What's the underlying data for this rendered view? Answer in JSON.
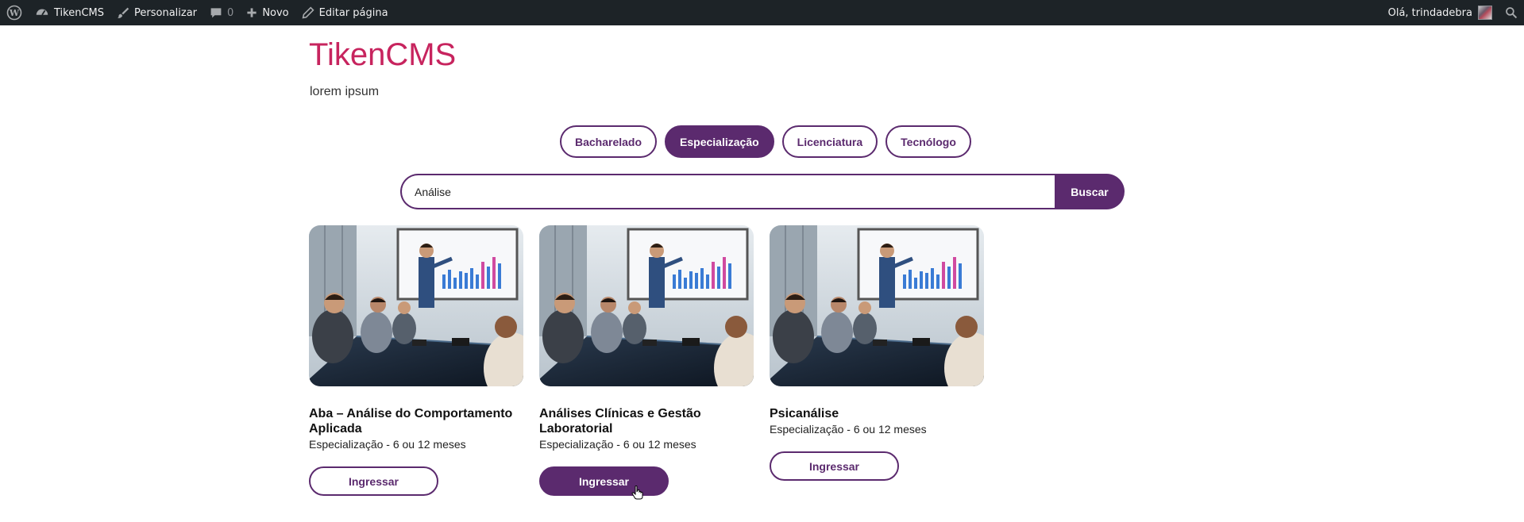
{
  "adminbar": {
    "site_name": "TikenCMS",
    "customize": "Personalizar",
    "comments_count": "0",
    "new": "Novo",
    "edit_page": "Editar página",
    "greeting": "Olá, trindadebra"
  },
  "header": {
    "title": "TikenCMS",
    "tagline": "lorem ipsum"
  },
  "filters": {
    "items": [
      {
        "label": "Bacharelado",
        "active": false
      },
      {
        "label": "Especialização",
        "active": true
      },
      {
        "label": "Licenciatura",
        "active": false
      },
      {
        "label": "Tecnólogo",
        "active": false
      }
    ]
  },
  "search": {
    "value": "Análise",
    "button_label": "Buscar"
  },
  "cards": [
    {
      "title": "Aba – Análise do Comportamento Aplicada",
      "subtitle": "Especialização - 6 ou 12 meses",
      "button": "Ingressar"
    },
    {
      "title": "Análises Clínicas e Gestão Laboratorial",
      "subtitle": "Especialização - 6 ou 12 meses",
      "button": "Ingressar"
    },
    {
      "title": "Psicanálise",
      "subtitle": "Especialização - 6 ou 12 meses",
      "button": "Ingressar"
    }
  ],
  "colors": {
    "brand": "#5b2a6e",
    "title": "#c7245e",
    "adminbar": "#1d2327"
  }
}
